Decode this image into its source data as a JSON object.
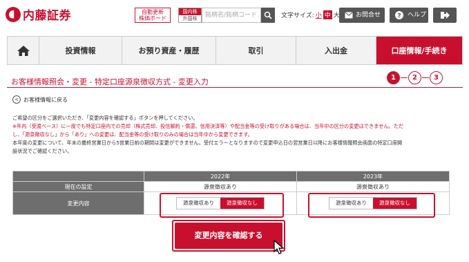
{
  "header": {
    "brand": "内藤証券",
    "board_button": [
      "自動更新",
      "株価ボード"
    ],
    "market_tag": {
      "top": "国内株",
      "bottom": "外国株"
    },
    "search_placeholder": "銘柄名/銘柄コード",
    "font_size_label": "文字サイズ:",
    "font_sizes": [
      "小",
      "中",
      "大"
    ],
    "contact_label": "お問合せ",
    "help_label": "ヘルプ"
  },
  "nav": {
    "items": [
      "投資情報",
      "お預り資産・履歴",
      "取引",
      "入出金",
      "口座情報/手続き"
    ]
  },
  "page": {
    "title": "お客様情報照会・変更 - 特定口座源泉徴収方式 - 変更入力",
    "steps": [
      "1",
      "2",
      "3"
    ],
    "back_label": "お客様情報に戻る",
    "desc_line1": "ご希望の区分をご選択いただき、「変更内容を確認する」ボタンを押してください。",
    "desc_red1": "※年内（受渡ベース）に一度でも特定口座内での売却（株式売却、投信解約・償還、信用決済等）や配当金等の受け取りがある場合は、当年中の区分の変更はできません。ただ",
    "desc_red2": "し、「源泉徴収なし」から「あり」への変更は、配当金等の受け取りのみの場合は当年中から変更できます。",
    "desc_line3": "本年度の変更について、年末の最終営業日から5営業日前の期間は変更ができません。受付エラーとなりますので変更申込日の翌営業日以降にお客様情報照会画面の特定口座開",
    "desc_line4": "設状況でご確認ください。"
  },
  "table": {
    "years": [
      "2022年",
      "2023年"
    ],
    "row_current": "現在の設定",
    "row_change": "変更内容",
    "current_values": [
      "源泉徴収あり",
      "源泉徴収あり"
    ],
    "option_with": "源泉徴収あり",
    "option_without": "源泉徴収なし",
    "selected": [
      "源泉徴収なし",
      "源泉徴収なし"
    ]
  },
  "confirm_label": "変更内容を確認する",
  "colors": {
    "brand": "#c8102e",
    "header_gray": "#6e6e6e",
    "nav_bg": "#f2f2f2"
  }
}
